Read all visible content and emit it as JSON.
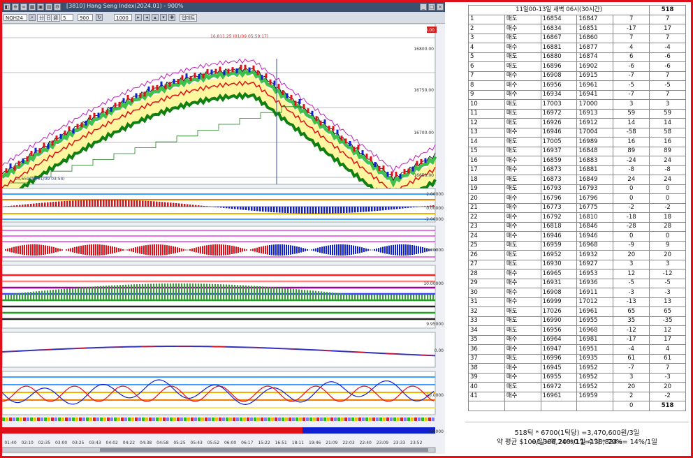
{
  "chart": {
    "window_title": "[3810] Hang Seng Index(2024.01) - 900%",
    "symbol": "NQH24",
    "period": "5",
    "count": "900",
    "range_value": "1000",
    "apply_button": "업데트",
    "price_labels": [
      "16800.00",
      "16750.00",
      "16700.00",
      "16650.00"
    ],
    "current_price": "17000.00",
    "annotation_top": "16,811.25 (01/09 05:59:17)",
    "annotation_low": "16,659.00(01/09 03:54)",
    "indicator_labels": [
      "2.00000",
      "0.00000",
      "-2.00000",
      "10.00000",
      "10.00000",
      "9.95000",
      "0.00",
      "20.0000",
      "0.00000"
    ],
    "time_labels": [
      "01:40",
      "02:10",
      "02:35",
      "03:00",
      "03:25",
      "03:43",
      "04:02",
      "04:22",
      "04:38",
      "04:58",
      "05:25",
      "05:43",
      "05:52",
      "06:00",
      "06:17",
      "15:22",
      "16:51",
      "18:11",
      "19:46",
      "21:09",
      "22:03",
      "22:40",
      "23:09",
      "23:33",
      "23:52"
    ],
    "colors": {
      "up": "#e0101a",
      "down": "#1020d0",
      "fill_up": "#fff6a0",
      "fill_green": "#10b020"
    }
  },
  "table": {
    "header": "11일00-13일 새벽 06시(30시간)",
    "header_total": "518",
    "rows": [
      [
        "1",
        "매도",
        "16854",
        "16847",
        "7",
        "7"
      ],
      [
        "2",
        "매수",
        "16834",
        "16851",
        "-17",
        "17"
      ],
      [
        "3",
        "매도",
        "16867",
        "16860",
        "7",
        "7"
      ],
      [
        "4",
        "매수",
        "16881",
        "16877",
        "4",
        "-4"
      ],
      [
        "5",
        "매도",
        "16880",
        "16874",
        "6",
        "-6"
      ],
      [
        "6",
        "매도",
        "16896",
        "16902",
        "-6",
        "-6"
      ],
      [
        "7",
        "매수",
        "16908",
        "16915",
        "-7",
        "7"
      ],
      [
        "8",
        "매수",
        "16956",
        "16961",
        "-5",
        "-5"
      ],
      [
        "9",
        "매수",
        "16934",
        "16941",
        "-7",
        "7"
      ],
      [
        "10",
        "매도",
        "17003",
        "17000",
        "3",
        "3"
      ],
      [
        "11",
        "매도",
        "16972",
        "16913",
        "59",
        "59"
      ],
      [
        "12",
        "매도",
        "16926",
        "16912",
        "14",
        "14"
      ],
      [
        "13",
        "매수",
        "16946",
        "17004",
        "-58",
        "58"
      ],
      [
        "14",
        "매도",
        "17005",
        "16989",
        "16",
        "16"
      ],
      [
        "15",
        "매도",
        "16937",
        "16848",
        "89",
        "89"
      ],
      [
        "16",
        "매수",
        "16859",
        "16883",
        "-24",
        "24"
      ],
      [
        "17",
        "매수",
        "16873",
        "16881",
        "-8",
        "-8"
      ],
      [
        "18",
        "매도",
        "16873",
        "16849",
        "24",
        "24"
      ],
      [
        "19",
        "매도",
        "16793",
        "16793",
        "0",
        "0"
      ],
      [
        "20",
        "매수",
        "16796",
        "16796",
        "0",
        "0"
      ],
      [
        "21",
        "매수",
        "16773",
        "16775",
        "-2",
        "-2"
      ],
      [
        "22",
        "매수",
        "16792",
        "16810",
        "-18",
        "18"
      ],
      [
        "23",
        "매수",
        "16818",
        "16846",
        "-28",
        "28"
      ],
      [
        "24",
        "매수",
        "16946",
        "16946",
        "0",
        "0"
      ],
      [
        "25",
        "매도",
        "16959",
        "16968",
        "-9",
        "9"
      ],
      [
        "26",
        "매도",
        "16952",
        "16932",
        "20",
        "20"
      ],
      [
        "27",
        "매도",
        "16930",
        "16927",
        "3",
        "3"
      ],
      [
        "28",
        "매수",
        "16965",
        "16953",
        "12",
        "-12"
      ],
      [
        "29",
        "매수",
        "16931",
        "16936",
        "-5",
        "-5"
      ],
      [
        "30",
        "매수",
        "16908",
        "16911",
        "-3",
        "-3"
      ],
      [
        "31",
        "매수",
        "16999",
        "17012",
        "-13",
        "13"
      ],
      [
        "32",
        "매도",
        "17026",
        "16961",
        "65",
        "65"
      ],
      [
        "33",
        "매도",
        "16990",
        "16955",
        "35",
        "-35"
      ],
      [
        "34",
        "매도",
        "16956",
        "16968",
        "-12",
        "12"
      ],
      [
        "35",
        "매수",
        "16964",
        "16981",
        "-17",
        "17"
      ],
      [
        "36",
        "매수",
        "16947",
        "16951",
        "-4",
        "4"
      ],
      [
        "37",
        "매도",
        "16996",
        "16935",
        "61",
        "61"
      ],
      [
        "38",
        "매수",
        "16945",
        "16952",
        "-7",
        "7"
      ],
      [
        "39",
        "매수",
        "16955",
        "16952",
        "3",
        "-3"
      ],
      [
        "40",
        "매도",
        "16972",
        "16952",
        "20",
        "20"
      ],
      [
        "41",
        "매수",
        "16961",
        "16959",
        "2",
        "-2"
      ]
    ],
    "footer_value": "0",
    "footer_total": "518",
    "summary_line1": "518틱 * 6700(1틱당) =3,470,600원/3일=1,388,240*0.1=138,824=",
    "summary_line2": "약 평균 $100/일=약 20%/1일 수익 * 70%= 14%/1일"
  }
}
